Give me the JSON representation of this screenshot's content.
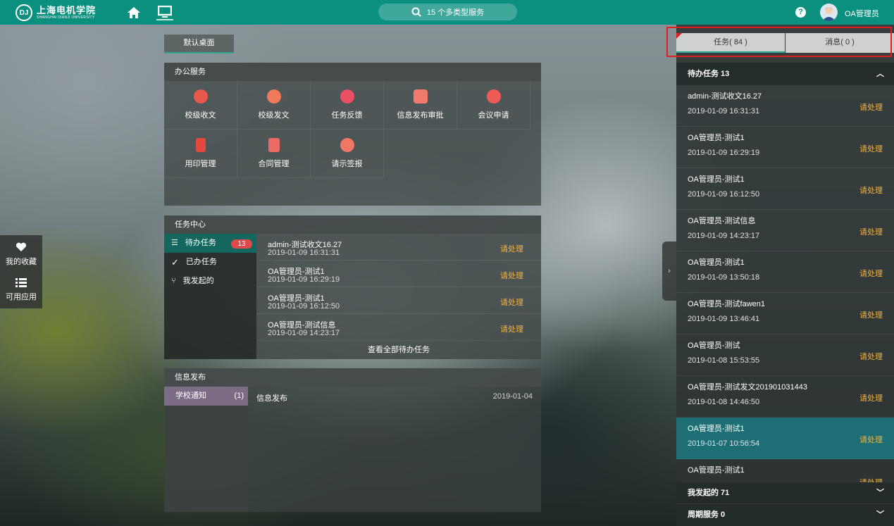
{
  "header": {
    "logo_mark": "DJ",
    "logo_cn": "上海电机学院",
    "logo_en": "SHANGHAI DIANJI UNIVERSITY",
    "search_text": "15 个多类型服务",
    "username": "OA管理员",
    "help": "?"
  },
  "desktop_tab": "默认桌面",
  "office": {
    "title": "办公服务",
    "items": [
      {
        "label": "校级收文",
        "icon": "inbox-doc-icon",
        "color": "#e8594b"
      },
      {
        "label": "校级发文",
        "icon": "send-doc-icon",
        "color": "#ef7a5a"
      },
      {
        "label": "任务反馈",
        "icon": "feedback-check-icon",
        "color": "#ea4f63"
      },
      {
        "label": "信息发布审批",
        "icon": "approval-pen-icon",
        "color": "#f07b6d"
      },
      {
        "label": "会议申请",
        "icon": "meeting-icon",
        "color": "#ee5a55"
      },
      {
        "label": "用印管理",
        "icon": "seal-icon",
        "color": "#e34a3d"
      },
      {
        "label": "合同管理",
        "icon": "contract-icon",
        "color": "#ec6a64"
      },
      {
        "label": "请示签报",
        "icon": "request-doc-icon",
        "color": "#f07766"
      }
    ]
  },
  "task_center": {
    "title": "任务中心",
    "nav": [
      {
        "label": "待办任务",
        "count": "13"
      },
      {
        "label": "已办任务"
      },
      {
        "label": "我发起的"
      }
    ],
    "rows": [
      {
        "title": "admin-测试收文16.27",
        "date": "2019-01-09 16:31:31",
        "action": "请处理"
      },
      {
        "title": "OA管理员-测试1",
        "date": "2019-01-09 16:29:19",
        "action": "请处理"
      },
      {
        "title": "OA管理员-测试1",
        "date": "2019-01-09 16:12:50",
        "action": "请处理"
      },
      {
        "title": "OA管理员-测试信息",
        "date": "2019-01-09 14:23:17",
        "action": "请处理"
      }
    ],
    "view_all": "查看全部待办任务"
  },
  "info": {
    "title": "信息发布",
    "category": "学校通知",
    "category_count": "(1)",
    "rows": [
      {
        "title": "信息发布",
        "date": "2019-01-04"
      }
    ]
  },
  "side_buttons": {
    "favorites": "我的收藏",
    "apps": "可用应用"
  },
  "right_panel": {
    "tab_tasks": "任务( 84 )",
    "tab_messages": "消息( 0 )",
    "pending_label": "待办任务  13",
    "items": [
      {
        "title": "admin-测试收文16.27",
        "date": "2019-01-09 16:31:31",
        "action": "请处理"
      },
      {
        "title": "OA管理员-测试1",
        "date": "2019-01-09 16:29:19",
        "action": "请处理"
      },
      {
        "title": "OA管理员-测试1",
        "date": "2019-01-09 16:12:50",
        "action": "请处理"
      },
      {
        "title": "OA管理员-测试信息",
        "date": "2019-01-09 14:23:17",
        "action": "请处理"
      },
      {
        "title": "OA管理员-测试1",
        "date": "2019-01-09 13:50:18",
        "action": "请处理"
      },
      {
        "title": "OA管理员-测试fawen1",
        "date": "2019-01-09 13:46:41",
        "action": "请处理"
      },
      {
        "title": "OA管理员-测试",
        "date": "2019-01-08 15:53:55",
        "action": "请处理"
      },
      {
        "title": "OA管理员-测试发文201901031443",
        "date": "2019-01-08 14:46:50",
        "action": "请处理"
      },
      {
        "title": "OA管理员-测试1",
        "date": "2019-01-07 10:56:54",
        "action": "请处理"
      },
      {
        "title": "OA管理员-测试1",
        "date": "",
        "action": "请处理"
      }
    ],
    "initiated_label": "我发起的  71",
    "periodic_label": "周期服务  0"
  }
}
